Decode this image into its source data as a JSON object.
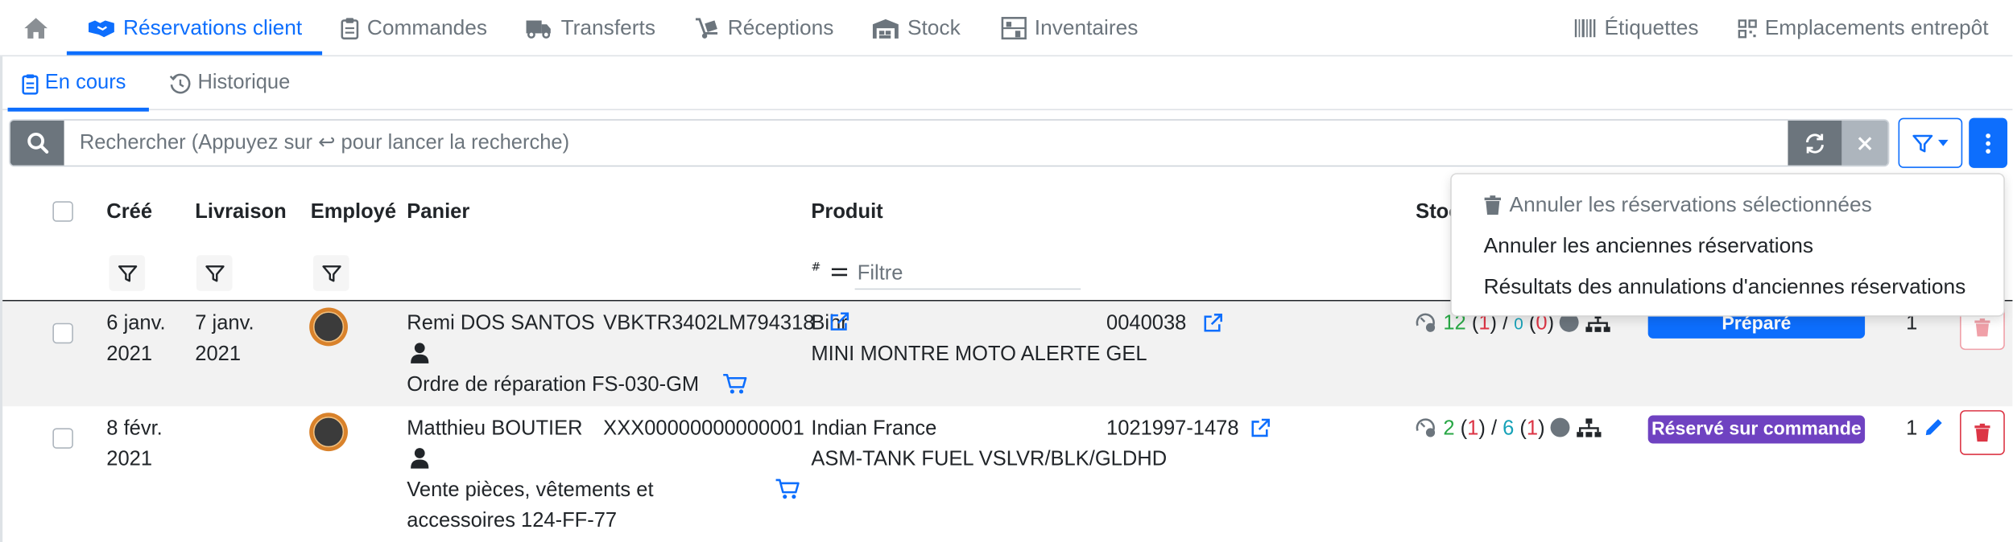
{
  "topnav": {
    "items": [
      {
        "label": "Réservations client"
      },
      {
        "label": "Commandes"
      },
      {
        "label": "Transferts"
      },
      {
        "label": "Réceptions"
      },
      {
        "label": "Stock"
      },
      {
        "label": "Inventaires"
      }
    ],
    "right": [
      {
        "label": "Étiquettes"
      },
      {
        "label": "Emplacements entrepôt"
      }
    ]
  },
  "subnav": {
    "tabs": [
      {
        "label": "En cours"
      },
      {
        "label": "Historique"
      }
    ]
  },
  "search": {
    "placeholder": "Rechercher (Appuyez sur ↩ pour lancer la recherche)"
  },
  "table": {
    "headers": {
      "cree": "Créé",
      "livraison": "Livraison",
      "employe": "Employé",
      "panier": "Panier",
      "produit": "Produit",
      "stock": "Stock"
    },
    "produit_filter_placeholder": "Filtre",
    "rows": [
      {
        "cree_1": "6 janv.",
        "cree_2": "2021",
        "livraison_1": "7 janv.",
        "livraison_2": "2021",
        "client": "Remi DOS SANTOS",
        "vin": "VBKTR3402LM794318",
        "panier_desc_1": "Ordre de réparation FS-030-GM",
        "brand": "Bihr",
        "ref": "0040038",
        "product_name": "MINI MONTRE MOTO ALERTE GEL",
        "stock_a": "12",
        "stock_b": "1",
        "stock_c": "0",
        "stock_d": "0",
        "status": "Préparé",
        "status_color": "#0d6efd",
        "qty": "1"
      },
      {
        "cree_1": "8 févr.",
        "cree_2": "2021",
        "livraison_1": "",
        "livraison_2": "",
        "client": "Matthieu BOUTIER",
        "vin": "XXX00000000000001",
        "panier_desc_1": "Vente pièces, vêtements et",
        "panier_desc_2": "accessoires 124-FF-77",
        "brand": "Indian France",
        "ref": "1021997-1478",
        "product_name": "ASM-TANK FUEL VSLVR/BLK/GLDHD",
        "stock_a": "2",
        "stock_b": "1",
        "stock_c": "6",
        "stock_d": "1",
        "status": "Réservé sur commande",
        "status_color": "#6f42c1",
        "qty": "1"
      }
    ]
  },
  "dropdown": {
    "items": [
      {
        "label": "Annuler les réservations sélectionnées"
      },
      {
        "label": "Annuler les anciennes réservations"
      },
      {
        "label": "Résultats des annulations d'anciennes réservations"
      }
    ]
  },
  "colors": {
    "accent": "#0d6efd",
    "muted": "#6c757d",
    "danger": "#dc3545",
    "success": "#28a745",
    "purple": "#6f42c1"
  }
}
